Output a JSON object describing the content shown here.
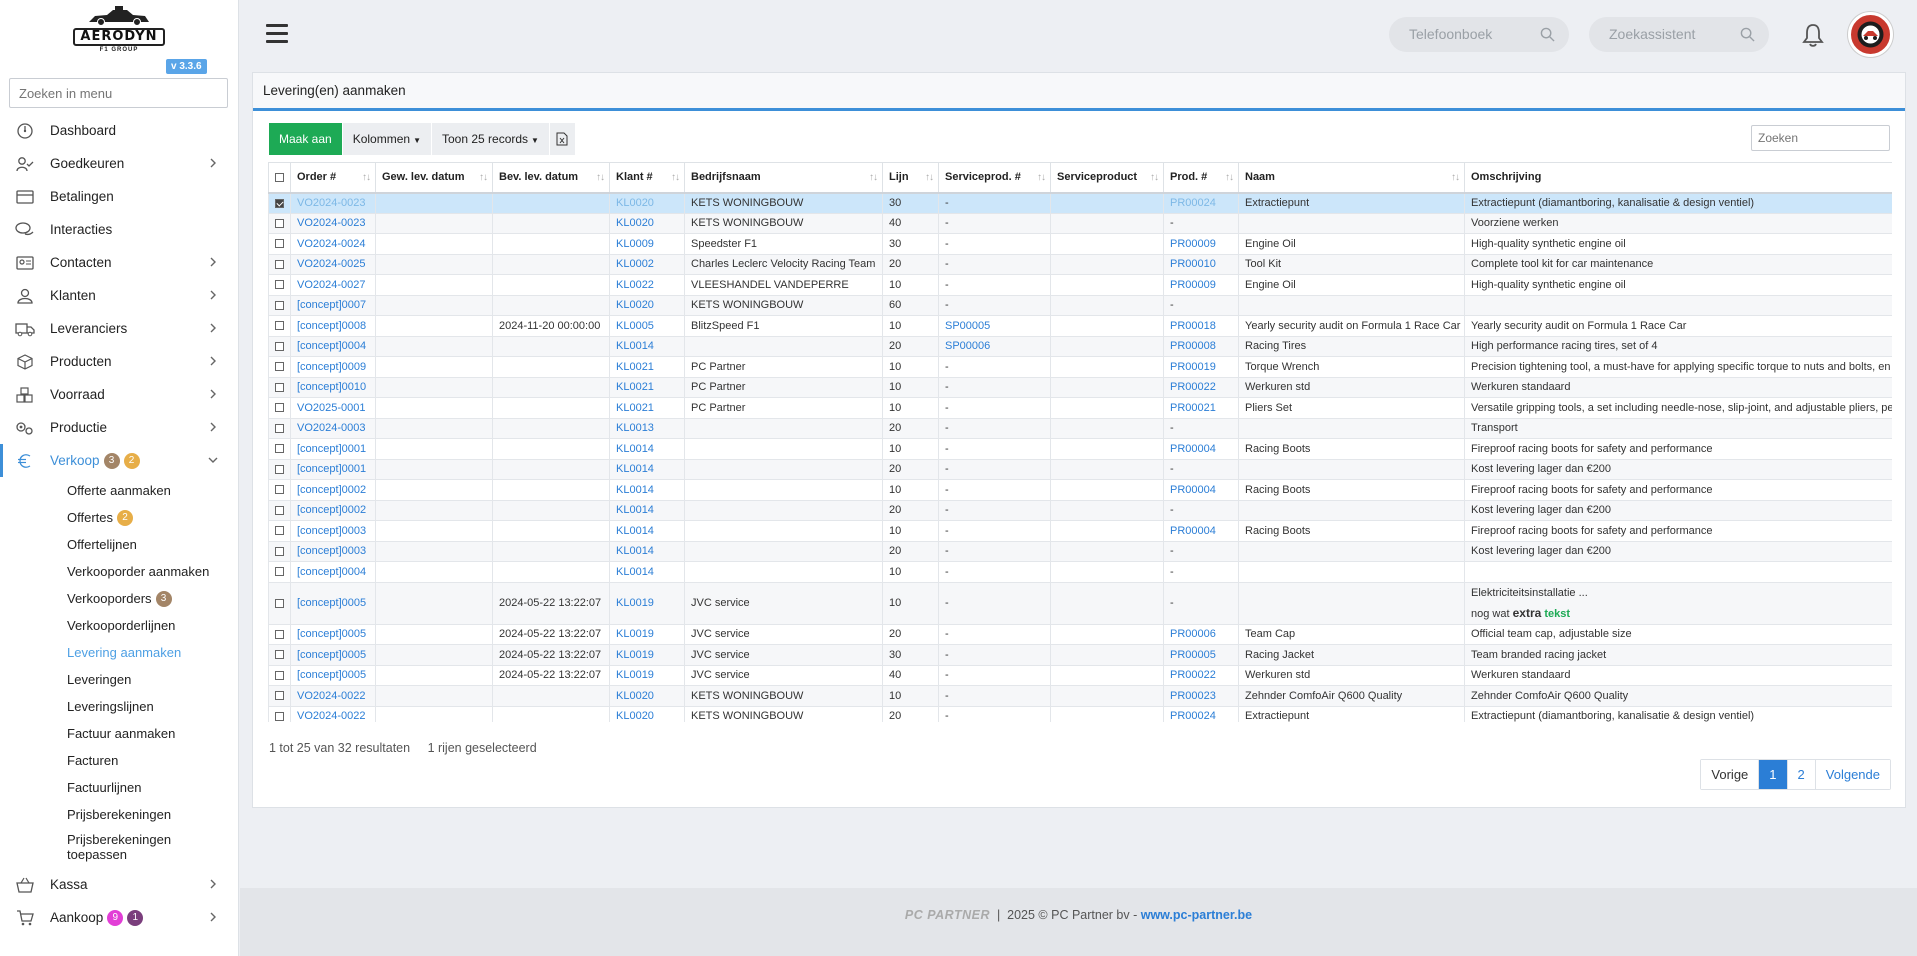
{
  "app": {
    "logo_text": "AERODYN",
    "logo_sub": "F1 GROUP",
    "version": "v 3.3.6",
    "menu_search_placeholder": "Zoeken in menu"
  },
  "sidebar": {
    "items": [
      {
        "label": "Dashboard",
        "icon": "dashboard-icon"
      },
      {
        "label": "Goedkeuren",
        "icon": "user-check-icon",
        "has_children": true
      },
      {
        "label": "Betalingen",
        "icon": "credit-card-icon"
      },
      {
        "label": "Interacties",
        "icon": "chat-bubbles-icon"
      },
      {
        "label": "Contacten",
        "icon": "contact-card-icon",
        "has_children": true
      },
      {
        "label": "Klanten",
        "icon": "user-icon",
        "has_children": true
      },
      {
        "label": "Leveranciers",
        "icon": "truck-icon",
        "has_children": true
      },
      {
        "label": "Producten",
        "icon": "box-icon",
        "has_children": true
      },
      {
        "label": "Voorraad",
        "icon": "boxes-icon",
        "has_children": true
      },
      {
        "label": "Productie",
        "icon": "gears-icon",
        "has_children": true
      }
    ],
    "verkoop": {
      "label": "Verkoop",
      "badge1": "3",
      "badge2": "2"
    },
    "sub_items": [
      {
        "label": "Offerte aanmaken"
      },
      {
        "label": "Offertes",
        "badge": "2"
      },
      {
        "label": "Offertelijnen"
      },
      {
        "label": "Verkooporder aanmaken"
      },
      {
        "label": "Verkooporders",
        "badge": "3"
      },
      {
        "label": "Verkooporderlijnen"
      },
      {
        "label": "Levering aanmaken"
      },
      {
        "label": "Leveringen"
      },
      {
        "label": "Leveringslijnen"
      },
      {
        "label": "Factuur aanmaken"
      },
      {
        "label": "Facturen"
      },
      {
        "label": "Factuurlijnen"
      },
      {
        "label": "Prijsberekeningen"
      },
      {
        "label": "Prijsberekeningen toepassen"
      }
    ],
    "kassa": {
      "label": "Kassa"
    },
    "aankoop": {
      "label": "Aankoop",
      "badge1": "9",
      "badge2": "1"
    }
  },
  "topbar": {
    "phonebook_placeholder": "Telefoonboek",
    "assistant_placeholder": "Zoekassistent"
  },
  "card": {
    "title": "Levering(en) aanmaken",
    "btn_create": "Maak aan",
    "btn_columns": "Kolommen",
    "btn_show": "Toon 25 records",
    "search_placeholder": "Zoeken",
    "columns": [
      "Order #",
      "Gew. lev. datum",
      "Bev. lev. datum",
      "Klant #",
      "Bedrijfsnaam",
      "Lijn",
      "Serviceprod. #",
      "Serviceproduct",
      "Prod. #",
      "Naam",
      "Omschrijving"
    ],
    "rows": [
      {
        "checked": true,
        "order": "VO2024-0023",
        "gew": "",
        "bev": "",
        "klant": "KL0020",
        "bedrijf": "KETS WONINGBOUW",
        "lijn": "30",
        "sp": "-",
        "sprod": "",
        "prod": "PR00024",
        "naam": "Extractiepunt",
        "omschr": "Extractiepunt (diamantboring, kanalisatie & design ventiel)"
      },
      {
        "order": "VO2024-0023",
        "gew": "",
        "bev": "",
        "klant": "KL0020",
        "bedrijf": "KETS WONINGBOUW",
        "lijn": "40",
        "sp": "-",
        "sprod": "",
        "prod": "-",
        "naam": "",
        "omschr": "Voorziene werken"
      },
      {
        "order": "VO2024-0024",
        "gew": "",
        "bev": "",
        "klant": "KL0009",
        "bedrijf": "Speedster F1",
        "lijn": "30",
        "sp": "-",
        "sprod": "",
        "prod": "PR00009",
        "naam": "Engine Oil",
        "omschr": "High-quality synthetic engine oil"
      },
      {
        "order": "VO2024-0025",
        "gew": "",
        "bev": "",
        "klant": "KL0002",
        "bedrijf": "Charles Leclerc Velocity Racing Team",
        "lijn": "20",
        "sp": "-",
        "sprod": "",
        "prod": "PR00010",
        "naam": "Tool Kit",
        "omschr": "Complete tool kit for car maintenance"
      },
      {
        "order": "VO2024-0027",
        "gew": "",
        "bev": "",
        "klant": "KL0022",
        "bedrijf": "VLEESHANDEL VANDEPERRE",
        "lijn": "10",
        "sp": "-",
        "sprod": "",
        "prod": "PR00009",
        "naam": "Engine Oil",
        "omschr": "High-quality synthetic engine oil"
      },
      {
        "order": "[concept]0007",
        "gew": "",
        "bev": "",
        "klant": "KL0020",
        "bedrijf": "KETS WONINGBOUW",
        "lijn": "60",
        "sp": "-",
        "sprod": "",
        "prod": "-",
        "naam": "",
        "omschr": ""
      },
      {
        "order": "[concept]0008",
        "gew": "",
        "bev": "2024-11-20 00:00:00",
        "klant": "KL0005",
        "bedrijf": "BlitzSpeed F1",
        "lijn": "10",
        "sp": "SP00005",
        "sprod": "",
        "prod": "PR00018",
        "naam": "Yearly security audit on Formula 1 Race Car",
        "omschr": "Yearly security audit on Formula 1 Race Car"
      },
      {
        "order": "[concept]0004",
        "gew": "",
        "bev": "",
        "klant": "KL0014",
        "bedrijf": "",
        "lijn": "20",
        "sp": "SP00006",
        "sprod": "",
        "prod": "PR00008",
        "naam": "Racing Tires",
        "omschr": "High performance racing tires, set of 4"
      },
      {
        "order": "[concept]0009",
        "gew": "",
        "bev": "",
        "klant": "KL0021",
        "bedrijf": "PC Partner",
        "lijn": "10",
        "sp": "-",
        "sprod": "",
        "prod": "PR00019",
        "naam": "Torque Wrench",
        "omschr": "Precision tightening tool, a must-have for applying specific torque to nuts and bolts, en"
      },
      {
        "order": "[concept]0010",
        "gew": "",
        "bev": "",
        "klant": "KL0021",
        "bedrijf": "PC Partner",
        "lijn": "10",
        "sp": "-",
        "sprod": "",
        "prod": "PR00022",
        "naam": "Werkuren std",
        "omschr": "Werkuren standaard"
      },
      {
        "order": "VO2025-0001",
        "gew": "",
        "bev": "",
        "klant": "KL0021",
        "bedrijf": "PC Partner",
        "lijn": "10",
        "sp": "-",
        "sprod": "",
        "prod": "PR00021",
        "naam": "Pliers Set",
        "omschr": "Versatile gripping tools, a set including needle-nose, slip-joint, and adjustable pliers, pe"
      },
      {
        "order": "VO2024-0003",
        "gew": "",
        "bev": "",
        "klant": "KL0013",
        "bedrijf": "",
        "lijn": "20",
        "sp": "-",
        "sprod": "",
        "prod": "-",
        "naam": "",
        "omschr": "Transport"
      },
      {
        "order": "[concept]0001",
        "gew": "",
        "bev": "",
        "klant": "KL0014",
        "bedrijf": "",
        "lijn": "10",
        "sp": "-",
        "sprod": "",
        "prod": "PR00004",
        "naam": "Racing Boots",
        "omschr": "Fireproof racing boots for safety and performance"
      },
      {
        "order": "[concept]0001",
        "gew": "",
        "bev": "",
        "klant": "KL0014",
        "bedrijf": "",
        "lijn": "20",
        "sp": "-",
        "sprod": "",
        "prod": "-",
        "naam": "",
        "omschr": "Kost levering lager dan €200"
      },
      {
        "order": "[concept]0002",
        "gew": "",
        "bev": "",
        "klant": "KL0014",
        "bedrijf": "",
        "lijn": "10",
        "sp": "-",
        "sprod": "",
        "prod": "PR00004",
        "naam": "Racing Boots",
        "omschr": "Fireproof racing boots for safety and performance"
      },
      {
        "order": "[concept]0002",
        "gew": "",
        "bev": "",
        "klant": "KL0014",
        "bedrijf": "",
        "lijn": "20",
        "sp": "-",
        "sprod": "",
        "prod": "-",
        "naam": "",
        "omschr": "Kost levering lager dan €200"
      },
      {
        "order": "[concept]0003",
        "gew": "",
        "bev": "",
        "klant": "KL0014",
        "bedrijf": "",
        "lijn": "10",
        "sp": "-",
        "sprod": "",
        "prod": "PR00004",
        "naam": "Racing Boots",
        "omschr": "Fireproof racing boots for safety and performance"
      },
      {
        "order": "[concept]0003",
        "gew": "",
        "bev": "",
        "klant": "KL0014",
        "bedrijf": "",
        "lijn": "20",
        "sp": "-",
        "sprod": "",
        "prod": "-",
        "naam": "",
        "omschr": "Kost levering lager dan €200"
      },
      {
        "order": "[concept]0004",
        "gew": "",
        "bev": "",
        "klant": "KL0014",
        "bedrijf": "",
        "lijn": "10",
        "sp": "-",
        "sprod": "",
        "prod": "-",
        "naam": "",
        "omschr": ""
      },
      {
        "order": "[concept]0005",
        "gew": "",
        "bev": "2024-05-22 13:22:07",
        "klant": "KL0019",
        "bedrijf": "JVC service",
        "lijn": "10",
        "sp": "-",
        "sprod": "",
        "prod": "-",
        "naam": "",
        "omschr": "Elektriciteitsinstallatie ...",
        "omschr2a": "nog wat ",
        "omschr2b": "extra",
        "omschr2c": "tekst",
        "tall": true
      },
      {
        "order": "[concept]0005",
        "gew": "",
        "bev": "2024-05-22 13:22:07",
        "klant": "KL0019",
        "bedrijf": "JVC service",
        "lijn": "20",
        "sp": "-",
        "sprod": "",
        "prod": "PR00006",
        "naam": "Team Cap",
        "omschr": "Official team cap, adjustable size"
      },
      {
        "order": "[concept]0005",
        "gew": "",
        "bev": "2024-05-22 13:22:07",
        "klant": "KL0019",
        "bedrijf": "JVC service",
        "lijn": "30",
        "sp": "-",
        "sprod": "",
        "prod": "PR00005",
        "naam": "Racing Jacket",
        "omschr": "Team branded racing jacket"
      },
      {
        "order": "[concept]0005",
        "gew": "",
        "bev": "2024-05-22 13:22:07",
        "klant": "KL0019",
        "bedrijf": "JVC service",
        "lijn": "40",
        "sp": "-",
        "sprod": "",
        "prod": "PR00022",
        "naam": "Werkuren std",
        "omschr": "Werkuren standaard"
      },
      {
        "order": "VO2024-0022",
        "gew": "",
        "bev": "",
        "klant": "KL0020",
        "bedrijf": "KETS WONINGBOUW",
        "lijn": "10",
        "sp": "-",
        "sprod": "",
        "prod": "PR00023",
        "naam": "Zehnder ComfoAir Q600 Quality",
        "omschr": "Zehnder ComfoAir Q600 Quality"
      },
      {
        "order": "VO2024-0022",
        "gew": "",
        "bev": "",
        "klant": "KL0020",
        "bedrijf": "KETS WONINGBOUW",
        "lijn": "20",
        "sp": "-",
        "sprod": "",
        "prod": "PR00024",
        "naam": "Extractiepunt",
        "omschr": "Extractiepunt (diamantboring, kanalisatie & design ventiel)"
      }
    ],
    "result_info": "1 tot 25 van 32 resultaten",
    "selected_info": "1 rijen geselecteerd",
    "pager": {
      "prev": "Vorige",
      "pages": [
        "1",
        "2"
      ],
      "next": "Volgende"
    }
  },
  "footer": {
    "brand": "PC PARTNER",
    "text": "  |  2025 © PC Partner bv - ",
    "link": "www.pc-partner.be"
  },
  "colors": {
    "accent": "#3d8fd8",
    "primary_button": "#1daa55",
    "selected_row": "#cce6fa"
  }
}
